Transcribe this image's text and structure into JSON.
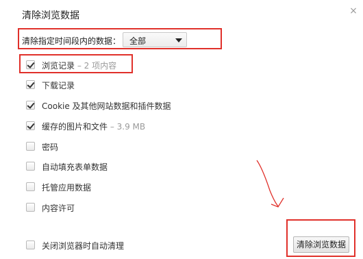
{
  "dialog": {
    "title": "清除浏览数据",
    "close_symbol": "×"
  },
  "time_range": {
    "label": "清除指定时间段内的数据：",
    "selected": "全部"
  },
  "options": [
    {
      "label": "浏览记录",
      "extra": " – 2 项内容",
      "checked": true
    },
    {
      "label": "下载记录",
      "extra": "",
      "checked": true
    },
    {
      "label": "Cookie 及其他网站数据和插件数据",
      "extra": "",
      "checked": true
    },
    {
      "label": "缓存的图片和文件",
      "extra": " – 3.9 MB",
      "checked": true
    },
    {
      "label": "密码",
      "extra": "",
      "checked": false
    },
    {
      "label": "自动填充表单数据",
      "extra": "",
      "checked": false
    },
    {
      "label": "托管应用数据",
      "extra": "",
      "checked": false
    },
    {
      "label": "内容许可",
      "extra": "",
      "checked": false
    }
  ],
  "auto_clear": {
    "label": "关闭浏览器时自动清理",
    "checked": false
  },
  "clear_button": {
    "label": "清除浏览数据"
  },
  "annotation_color": "#e0302a"
}
